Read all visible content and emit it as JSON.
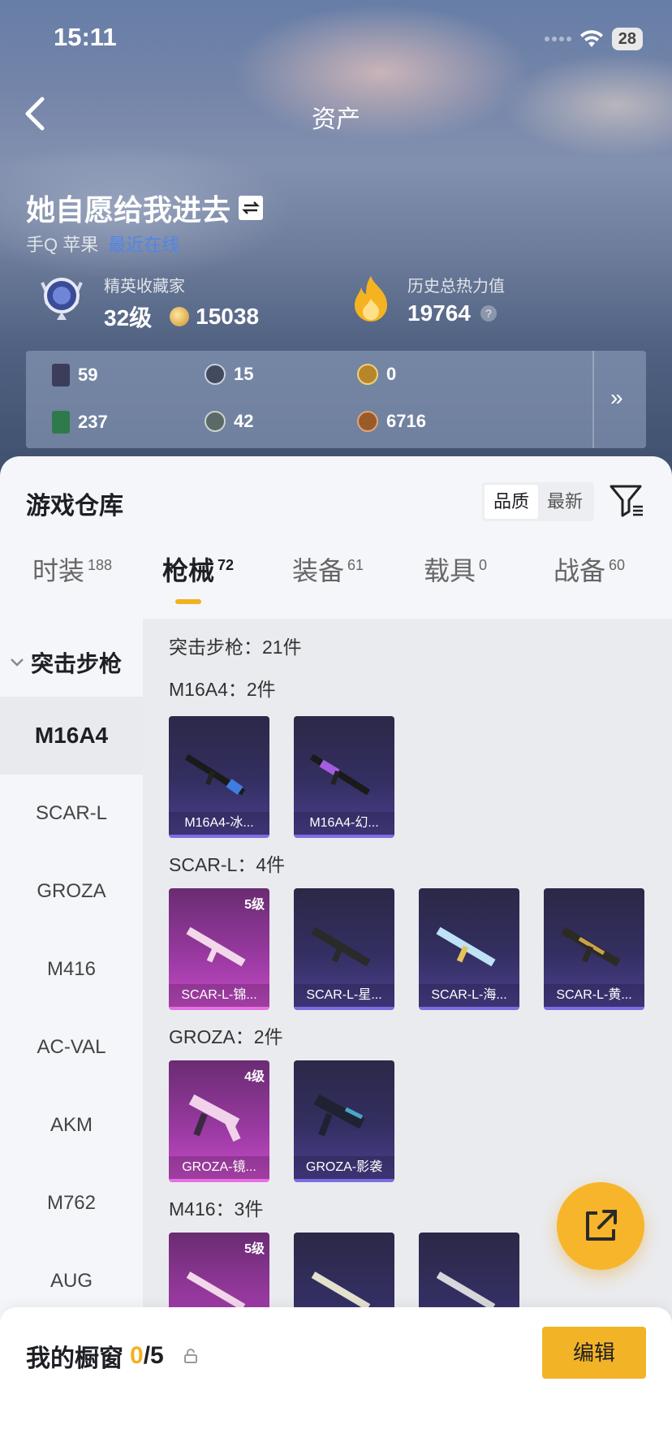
{
  "status": {
    "time": "15:11",
    "battery": "28"
  },
  "header": {
    "title": "资产"
  },
  "profile": {
    "name": "她自愿给我进去",
    "platform": "手Q 苹果",
    "online": "最近在线"
  },
  "rank": {
    "label": "精英收藏家",
    "level": "32级",
    "coins": "15038"
  },
  "heat": {
    "label": "历史总热力值",
    "value": "19764",
    "help": "?"
  },
  "stats": [
    {
      "icon": "card-icon",
      "value": "59",
      "color": "#3b3d5a"
    },
    {
      "icon": "badge-icon",
      "value": "15",
      "color": "#414a5e"
    },
    {
      "icon": "gold-emblem-icon",
      "value": "0",
      "color": "#b8862a"
    },
    {
      "icon": "green-card-icon",
      "value": "237",
      "color": "#2f7a4a"
    },
    {
      "icon": "grey-emblem-icon",
      "value": "42",
      "color": "#5b6a66"
    },
    {
      "icon": "bronze-emblem-icon",
      "value": "6716",
      "color": "#9a5a2a"
    }
  ],
  "warehouse": {
    "title": "游戏仓库",
    "sort": [
      "品质",
      "最新"
    ]
  },
  "tabs": [
    {
      "label": "时装",
      "count": "188"
    },
    {
      "label": "枪械",
      "count": "72"
    },
    {
      "label": "装备",
      "count": "61"
    },
    {
      "label": "载具",
      "count": "0"
    },
    {
      "label": "战备",
      "count": "60"
    }
  ],
  "sidebar": {
    "category": "突击步枪",
    "items": [
      "M16A4",
      "SCAR-L",
      "GROZA",
      "M416",
      "AC-VAL",
      "AKM",
      "M762",
      "AUG"
    ]
  },
  "content": {
    "summary": "突击步枪：21件",
    "groups": [
      {
        "label": "M16A4：2件",
        "items": [
          {
            "name": "M16A4-冰...",
            "level": ""
          },
          {
            "name": "M16A4-幻...",
            "level": ""
          }
        ]
      },
      {
        "label": "SCAR-L：4件",
        "items": [
          {
            "name": "SCAR-L-锦...",
            "level": "5级"
          },
          {
            "name": "SCAR-L-星...",
            "level": ""
          },
          {
            "name": "SCAR-L-海...",
            "level": ""
          },
          {
            "name": "SCAR-L-黄...",
            "level": ""
          }
        ]
      },
      {
        "label": "GROZA：2件",
        "items": [
          {
            "name": "GROZA-镜...",
            "level": "4级"
          },
          {
            "name": "GROZA-影袭",
            "level": ""
          }
        ]
      },
      {
        "label": "M416：3件",
        "items": [
          {
            "name": "",
            "level": "5级"
          },
          {
            "name": "",
            "level": ""
          },
          {
            "name": "",
            "level": ""
          }
        ]
      }
    ]
  },
  "showcase": {
    "title": "我的橱窗",
    "used": "0",
    "total": "/5",
    "edit": "编辑"
  }
}
